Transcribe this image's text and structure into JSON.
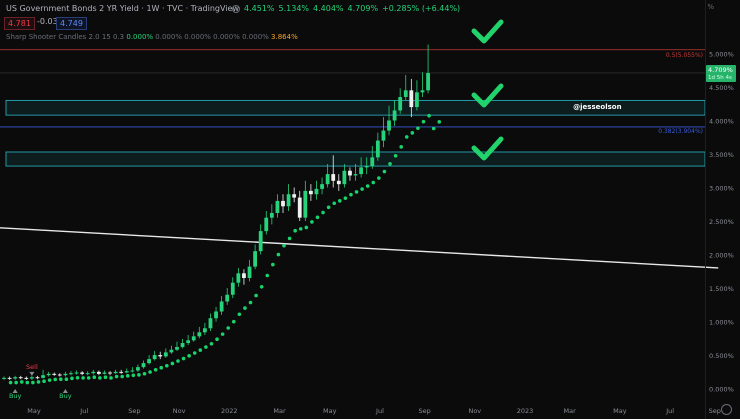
{
  "header": {
    "title": "US Government Bonds 2 YR Yield · 1W · TVC · TradingView",
    "ohlc": [
      "4.451%",
      "5.134%",
      "4.404%",
      "4.709%",
      "+0.285% (+6.44%)"
    ],
    "sell_price": "4.781",
    "change": "-0.032",
    "buy_price": "4.749",
    "indicator": {
      "name": "Sharp Shooter Candles  2.0  15  0.3",
      "values": [
        "0.000%",
        "0.000%",
        "0.000%",
        "0.000%",
        "0.000%"
      ],
      "last": "3.864%"
    },
    "corner_label": "%"
  },
  "colors": {
    "background": "#0b0b0b",
    "bull": "#26d37a",
    "bear": "#f0f0f0",
    "fib_red": "#c23b3b",
    "fib_blue": "#3a5bd9",
    "zone": "#2ab7c9",
    "trendline": "#e8e8e8",
    "check": "#22d36b"
  },
  "chart_data": {
    "type": "candlestick",
    "title": "US Government Bonds 2 YR Yield",
    "y_axis": {
      "ylim": [
        -0.2,
        5.35
      ],
      "ticks": [
        0,
        0.5,
        1,
        1.5,
        2,
        2.5,
        3,
        3.5,
        4,
        4.5,
        5
      ],
      "tick_labels": [
        "0.000%",
        "0.500%",
        "1.000%",
        "1.500%",
        "2.000%",
        "2.500%",
        "3.000%",
        "3.500%",
        "4.000%",
        "4.500%",
        "5.000%"
      ],
      "position": "right"
    },
    "x_axis": {
      "labels": [
        "May",
        "Jul",
        "Sep",
        "Nov",
        "2022",
        "Mar",
        "May",
        "Jul",
        "Sep",
        "Nov",
        "2023",
        "Mar",
        "May",
        "Jul",
        "Sep"
      ],
      "label_weeks": [
        0,
        9,
        18,
        26,
        35,
        44,
        53,
        62,
        70,
        79,
        88,
        96,
        105,
        114,
        122
      ]
    },
    "last_price": "4.709%",
    "last_countdown": "1d 5h 4s",
    "fib_levels": [
      {
        "label": "0.5(5.055%)",
        "value": 5.055,
        "color": "red"
      },
      {
        "label": "0.382(3.904%)",
        "value": 3.904,
        "color": "blue"
      }
    ],
    "zones": [
      {
        "from": 4.08,
        "to": 4.3
      },
      {
        "from": 3.32,
        "to": 3.53
      }
    ],
    "trendline": {
      "start": {
        "week": -1,
        "value": 2.4
      },
      "end": {
        "week": 128,
        "value": 1.8
      }
    },
    "annotations": [
      {
        "text": "@jesseolson",
        "week": 102,
        "value": 4.2
      },
      {
        "text": "Sell",
        "week": 5,
        "value": 0.25
      },
      {
        "text": "Buy",
        "week": 2,
        "value": -0.1
      },
      {
        "text": "Buy",
        "week": 11,
        "value": -0.1
      }
    ],
    "candles": {
      "open": [
        0.15,
        0.16,
        0.15,
        0.17,
        0.16,
        0.15,
        0.17,
        0.16,
        0.2,
        0.22,
        0.21,
        0.2,
        0.22,
        0.23,
        0.24,
        0.22,
        0.23,
        0.25,
        0.22,
        0.24,
        0.23,
        0.25,
        0.24,
        0.26,
        0.27,
        0.32,
        0.38,
        0.44,
        0.5,
        0.48,
        0.54,
        0.58,
        0.62,
        0.68,
        0.72,
        0.78,
        0.84,
        0.9,
        1.05,
        1.15,
        1.3,
        1.4,
        1.58,
        1.72,
        1.65,
        1.82,
        2.05,
        2.35,
        2.55,
        2.62,
        2.8,
        2.72,
        2.9,
        2.85,
        2.55,
        2.95,
        2.9,
        2.98,
        3.05,
        3.2,
        3.1,
        3.05,
        3.25,
        3.18,
        3.2,
        3.3,
        3.32,
        3.45,
        3.7,
        3.85,
        4.0,
        4.15,
        4.35,
        4.45,
        4.2,
        4.42,
        4.45
      ],
      "close": [
        0.16,
        0.15,
        0.17,
        0.16,
        0.15,
        0.17,
        0.16,
        0.2,
        0.22,
        0.21,
        0.2,
        0.22,
        0.23,
        0.24,
        0.22,
        0.23,
        0.25,
        0.22,
        0.24,
        0.23,
        0.25,
        0.24,
        0.26,
        0.27,
        0.32,
        0.38,
        0.44,
        0.5,
        0.48,
        0.54,
        0.58,
        0.62,
        0.68,
        0.72,
        0.78,
        0.84,
        0.9,
        1.05,
        1.15,
        1.3,
        1.4,
        1.58,
        1.72,
        1.65,
        1.82,
        2.05,
        2.35,
        2.55,
        2.62,
        2.8,
        2.72,
        2.9,
        2.85,
        2.55,
        2.95,
        2.9,
        2.98,
        3.05,
        3.2,
        3.1,
        3.05,
        3.25,
        3.18,
        3.2,
        3.3,
        3.32,
        3.45,
        3.7,
        3.85,
        4.0,
        4.15,
        4.35,
        4.45,
        4.2,
        4.42,
        4.45,
        4.709
      ],
      "high": [
        0.18,
        0.18,
        0.19,
        0.19,
        0.18,
        0.19,
        0.19,
        0.28,
        0.25,
        0.24,
        0.23,
        0.25,
        0.26,
        0.27,
        0.26,
        0.26,
        0.28,
        0.27,
        0.27,
        0.26,
        0.28,
        0.28,
        0.3,
        0.32,
        0.36,
        0.42,
        0.5,
        0.56,
        0.55,
        0.6,
        0.64,
        0.7,
        0.74,
        0.8,
        0.85,
        0.92,
        0.98,
        1.12,
        1.22,
        1.38,
        1.5,
        1.66,
        1.8,
        1.78,
        1.92,
        2.15,
        2.45,
        2.65,
        2.75,
        2.9,
        2.9,
        3.05,
        3.0,
        2.95,
        3.1,
        3.05,
        3.1,
        3.15,
        3.35,
        3.48,
        3.2,
        3.35,
        3.3,
        3.35,
        3.45,
        3.45,
        3.62,
        3.82,
        4.05,
        4.22,
        4.3,
        4.48,
        4.68,
        4.62,
        4.6,
        4.72,
        5.134
      ],
      "low": [
        0.13,
        0.13,
        0.13,
        0.14,
        0.13,
        0.13,
        0.14,
        0.15,
        0.18,
        0.19,
        0.18,
        0.18,
        0.2,
        0.21,
        0.2,
        0.2,
        0.21,
        0.2,
        0.21,
        0.2,
        0.22,
        0.22,
        0.23,
        0.24,
        0.25,
        0.3,
        0.36,
        0.42,
        0.44,
        0.46,
        0.52,
        0.56,
        0.6,
        0.65,
        0.7,
        0.75,
        0.8,
        0.86,
        1.0,
        1.1,
        1.25,
        1.35,
        1.52,
        1.55,
        1.6,
        1.78,
        2.0,
        2.3,
        2.45,
        2.55,
        2.62,
        2.65,
        2.78,
        2.5,
        2.5,
        2.8,
        2.82,
        2.9,
        3.0,
        3.0,
        2.95,
        3.0,
        3.1,
        3.1,
        3.15,
        3.2,
        3.28,
        3.4,
        3.6,
        3.78,
        3.92,
        4.1,
        4.3,
        4.05,
        4.15,
        4.35,
        4.404
      ]
    }
  }
}
